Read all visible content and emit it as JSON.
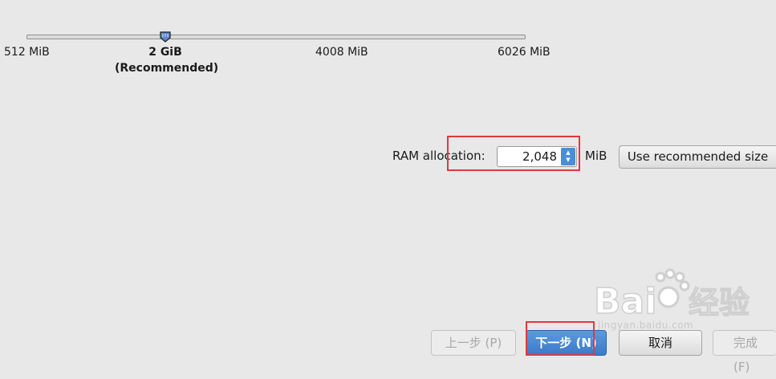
{
  "slider": {
    "ticks": {
      "min": "512 MiB",
      "recommended_value": "2 GiB",
      "recommended_note": "(Recommended)",
      "mid": "4008 MiB",
      "max": "6026 MiB"
    },
    "range_mib": [
      512,
      6026
    ],
    "current_mib": 2048
  },
  "ram": {
    "label": "RAM allocation:",
    "value": "2,048",
    "unit": "MiB",
    "use_recommended_label": "Use recommended size"
  },
  "footer": {
    "prev_label": "上一步 (P)",
    "next_label": "下一步 (N)",
    "cancel_label": "取消",
    "finish_label": "完成 (F)"
  },
  "watermark": {
    "brand": "Bai经验",
    "url": "jingyan.baidu.com"
  },
  "colors": {
    "background": "#e8e8e8",
    "accent": "#3d79c8",
    "highlight": "#e03a3a"
  }
}
